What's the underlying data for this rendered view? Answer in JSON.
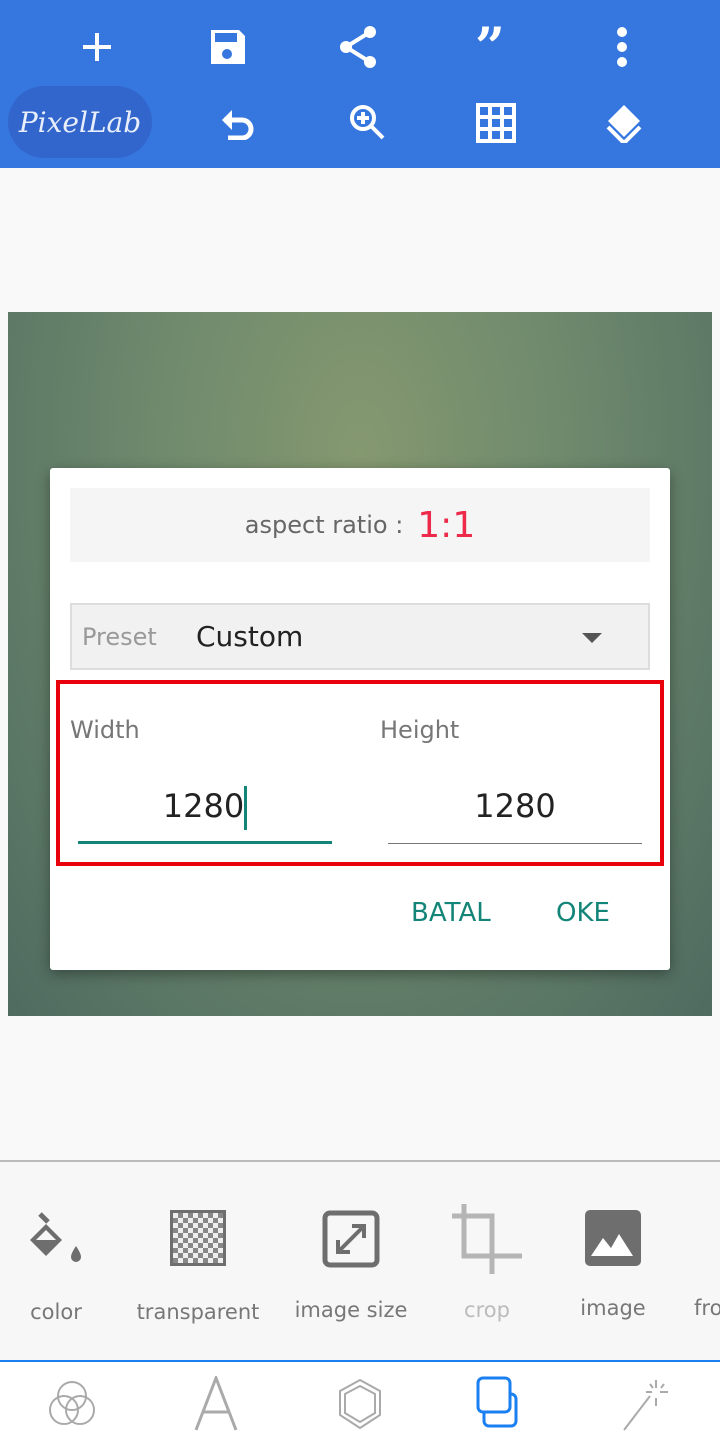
{
  "topbar": {
    "logo": "PixelLab",
    "icons": [
      "add-icon",
      "save-icon",
      "share-icon",
      "quote-icon",
      "more-vert-icon",
      "undo-icon",
      "zoom-in-icon",
      "grid-icon",
      "layers-icon"
    ]
  },
  "dialog": {
    "aspect_label": "aspect ratio :",
    "aspect_value": "1:1",
    "preset_label": "Preset",
    "preset_value": "Custom",
    "width_label": "Width",
    "width_value": "1280",
    "height_label": "Height",
    "height_value": "1280",
    "cancel": "BATAL",
    "ok": "OKE"
  },
  "tools": [
    {
      "label": "color",
      "icon": "paint-bucket-icon"
    },
    {
      "label": "transparent",
      "icon": "checkerboard-icon"
    },
    {
      "label": "image size",
      "icon": "resize-icon"
    },
    {
      "label": "crop",
      "icon": "crop-icon",
      "disabled": true
    },
    {
      "label": "image",
      "icon": "image-icon"
    },
    {
      "label": "fro"
    }
  ],
  "nav": [
    "blend-icon",
    "text-icon",
    "shape-icon",
    "background-icon",
    "effects-icon"
  ],
  "colors": {
    "topbar": "#3676df",
    "accent": "#138578",
    "aspect": "#ee2a4a",
    "active_nav": "#1a7ff0"
  }
}
